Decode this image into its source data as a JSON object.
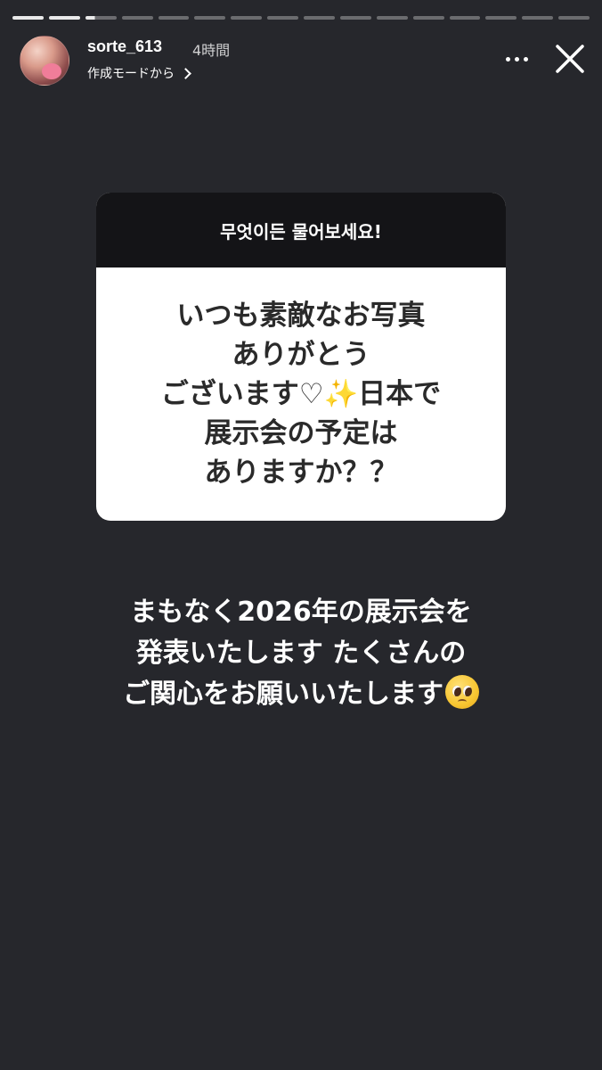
{
  "progress": {
    "segments": 16,
    "completed": 2,
    "active_index": 2,
    "active_fraction": 0.3
  },
  "header": {
    "username": "sorte_613",
    "time": "4時間",
    "subline": "作成モードから"
  },
  "question_sticker": {
    "prompt": "무엇이든 물어보세요!",
    "lines": [
      "いつも素敵なお写真",
      "ありがとう",
      "ございます♡✨日本で",
      "展示会の予定は",
      "ありますか？？"
    ]
  },
  "reply": {
    "lines": [
      "まもなく2026年の展示会を",
      "発表いたします  たくさんの",
      "ご関心をお願いいたします"
    ],
    "emoji": "pleading-face"
  },
  "colors": {
    "background": "#26272c",
    "sticker_header": "#141417",
    "sticker_body": "#ffffff"
  }
}
